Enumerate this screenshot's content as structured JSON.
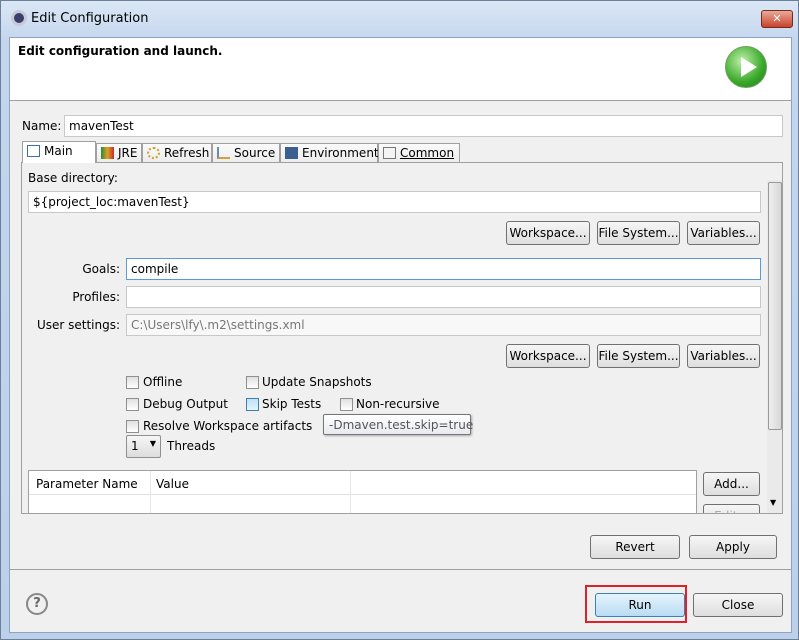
{
  "window": {
    "title": "Edit Configuration",
    "close": "✕"
  },
  "header": {
    "text": "Edit configuration and launch."
  },
  "name": {
    "label": "Name:",
    "value": "mavenTest"
  },
  "tabs": [
    {
      "label": "Main",
      "icon": "main-icon"
    },
    {
      "label": "JRE",
      "icon": "jre-icon"
    },
    {
      "label": "Refresh",
      "icon": "refresh-icon"
    },
    {
      "label": "Source",
      "icon": "source-icon"
    },
    {
      "label": "Environment",
      "icon": "environment-icon"
    },
    {
      "label": "Common",
      "icon": "common-icon"
    }
  ],
  "main": {
    "base_dir_label": "Base directory:",
    "base_dir_value": "${project_loc:mavenTest}",
    "workspace_btn": "Workspace...",
    "filesystem_btn": "File System...",
    "variables_btn": "Variables...",
    "goals_label": "Goals:",
    "goals_value": "compile",
    "profiles_label": "Profiles:",
    "profiles_value": "",
    "user_settings_label": "User settings:",
    "user_settings_value": "C:\\Users\\lfy\\.m2\\settings.xml",
    "checkboxes": {
      "offline": "Offline",
      "update_snapshots": "Update Snapshots",
      "debug_output": "Debug Output",
      "skip_tests": "Skip Tests",
      "non_recursive": "Non-recursive",
      "resolve_workspace": "Resolve Workspace artifacts"
    },
    "tooltip": "-Dmaven.test.skip=true",
    "threads_value": "1",
    "threads_label": "Threads",
    "table_headers": [
      "Parameter Name",
      "Value"
    ],
    "add_btn": "Add...",
    "edit_btn": "Edit..."
  },
  "revert_btn": "Revert",
  "apply_btn": "Apply",
  "run_btn": "Run",
  "close_btn": "Close",
  "highlight_color": "#e0202a"
}
